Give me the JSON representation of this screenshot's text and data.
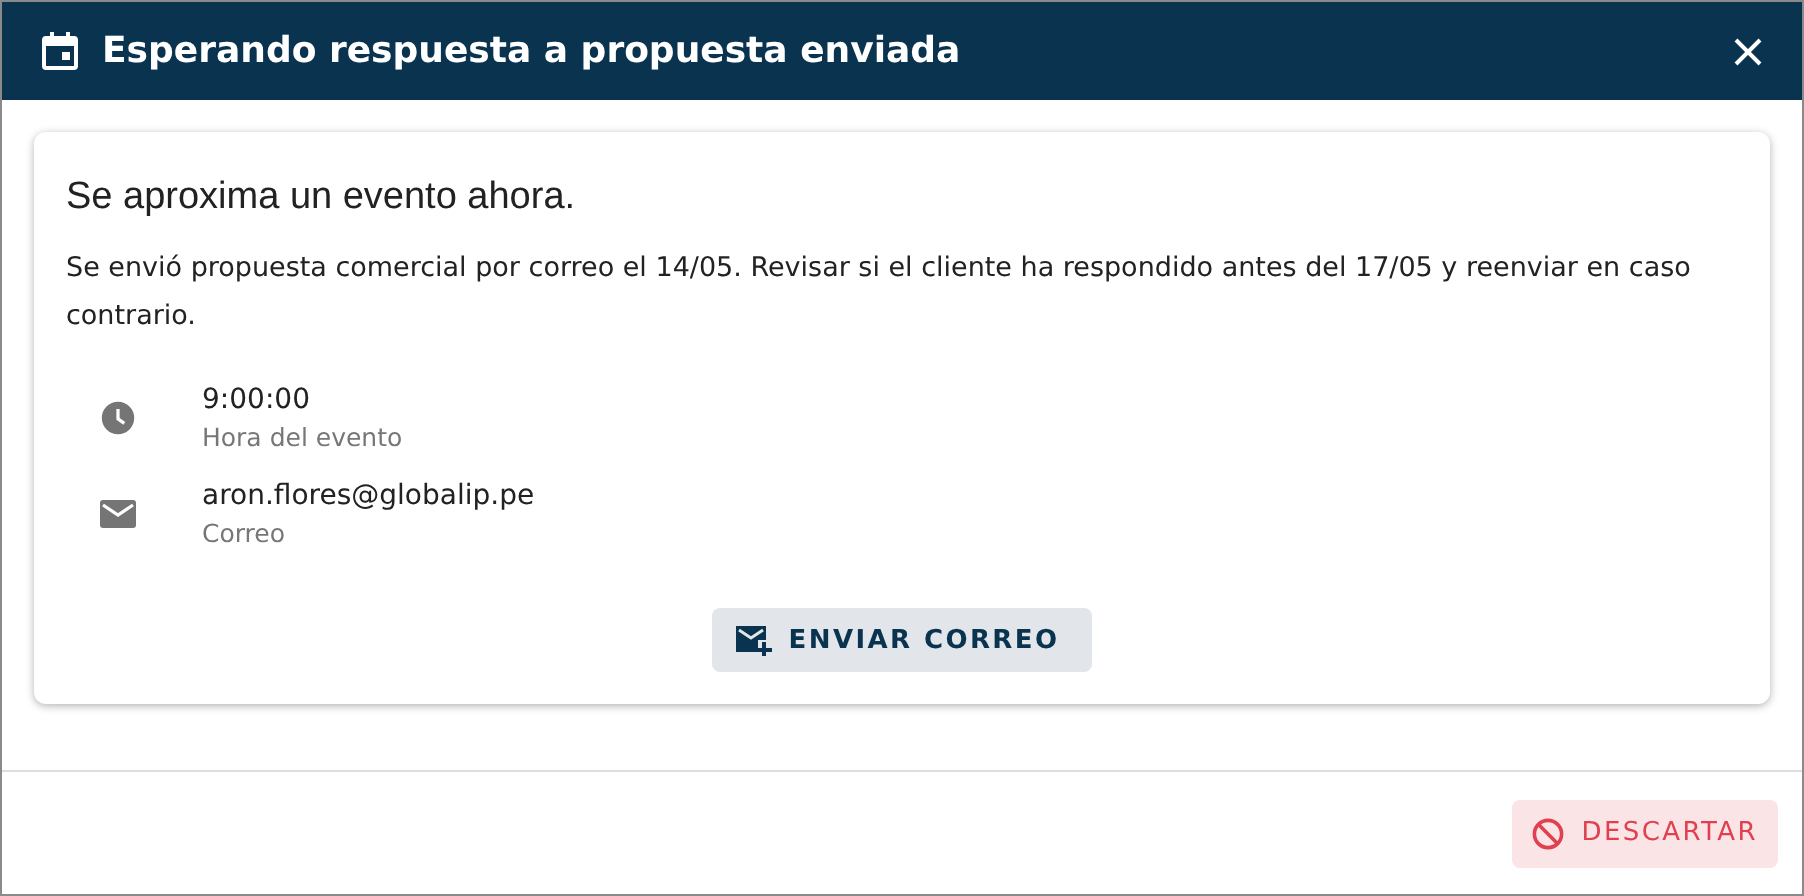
{
  "dialog": {
    "title": "Esperando respuesta a propuesta enviada"
  },
  "card": {
    "heading": "Se aproxima un evento ahora.",
    "description": "Se envió propuesta comercial por correo el 14/05. Revisar si el cliente ha respondido antes del 17/05 y reenviar en caso contrario.",
    "details": [
      {
        "kind": "time",
        "value": "9:00:00",
        "label": "Hora del evento"
      },
      {
        "kind": "email",
        "value": "aron.flores@globalip.pe",
        "label": "Correo"
      }
    ],
    "action": "ENVIAR CORREO"
  },
  "footer": {
    "button": "DESCARTAR"
  }
}
